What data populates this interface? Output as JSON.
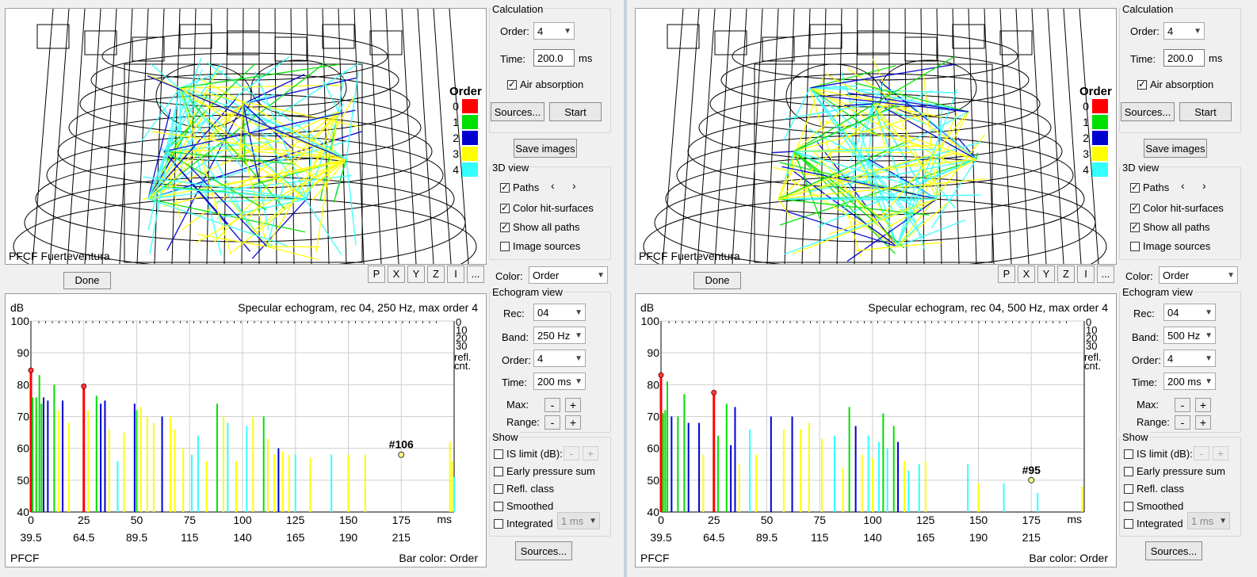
{
  "legend_colors": {
    "o0": "#ff0000",
    "o1": "#00e000",
    "o2": "#0000d0",
    "o3": "#ffff00",
    "o4": "#33ffff"
  },
  "panes": [
    {
      "room_label": "PFCF Fuerteventura",
      "legend": {
        "title": "Order",
        "items": [
          "0",
          "1",
          "2",
          "3",
          "4"
        ]
      },
      "status": "Done",
      "view_buttons": [
        "P",
        "X",
        "Y",
        "Z",
        "I",
        "..."
      ],
      "calc": {
        "title": "Calculation",
        "order_label": "Order:",
        "order_value": "4",
        "time_label": "Time:",
        "time_value": "200.0",
        "time_unit": "ms",
        "air_absorption": "Air absorption",
        "sources_btn": "Sources...",
        "start_btn": "Start"
      },
      "save_images": "Save images",
      "view3d": {
        "title": "3D view",
        "paths": "Paths",
        "nav_prev": "‹",
        "nav_next": "›",
        "color_hit": "Color hit-surfaces",
        "show_all": "Show all paths",
        "image_sources": "Image sources"
      },
      "color": {
        "label": "Color:",
        "value": "Order"
      },
      "echo_panel": {
        "title": "Echogram view",
        "rec_label": "Rec:",
        "rec_value": "04",
        "band_label": "Band:",
        "band_value": "250 Hz",
        "order_label": "Order:",
        "order_value": "4",
        "time_label": "Time:",
        "time_value": "200 ms",
        "max_label": "Max:",
        "range_label": "Range:",
        "minus": "-",
        "plus": "+"
      },
      "show": {
        "title": "Show",
        "is_limit": "IS limit (dB):",
        "early": "Early pressure sum",
        "refl": "Refl. class",
        "smoothed": "Smoothed",
        "integrated": "Integrated",
        "int_value": "1 ms",
        "minus": "-",
        "plus": "+"
      },
      "sources_bottom": "Sources...",
      "echogram": {
        "title": "Specular echogram, rec 04, 250 Hz, max order 4",
        "ylabel": "dB",
        "xunit": "ms",
        "footer_left": "PFCF",
        "footer_right": "Bar color: Order",
        "refl_ticks": [
          "0",
          "10",
          "20",
          "30"
        ],
        "refl_label1": "refl.",
        "refl_label2": "cnt.",
        "marker_label": "#106"
      },
      "chart_data": {
        "type": "bar",
        "title": "Specular echogram, rec 04, 250 Hz, max order 4",
        "ylabel": "dB",
        "xlabel": "ms",
        "ylim": [
          40,
          100
        ],
        "xlim": [
          0,
          200
        ],
        "yticks": [
          40,
          50,
          60,
          70,
          80,
          90,
          100
        ],
        "xticks": [
          0,
          25,
          50,
          75,
          100,
          125,
          150,
          175
        ],
        "xticks2": [
          "39.5",
          "64.5",
          "89.5",
          "115",
          "140",
          "165",
          "190",
          "215"
        ],
        "grid": true,
        "marker": {
          "x": 175,
          "y": 58,
          "label": "#106"
        },
        "bars": [
          {
            "x": 0,
            "v": 84.5,
            "o": 0
          },
          {
            "x": 0.8,
            "v": 76,
            "o": 1
          },
          {
            "x": 2.5,
            "v": 76,
            "o": 1
          },
          {
            "x": 4,
            "v": 83,
            "o": 1
          },
          {
            "x": 5,
            "v": 74,
            "o": 1
          },
          {
            "x": 6,
            "v": 76,
            "o": 2
          },
          {
            "x": 8,
            "v": 75,
            "o": 2
          },
          {
            "x": 11,
            "v": 80,
            "o": 1
          },
          {
            "x": 13,
            "v": 72,
            "o": 3
          },
          {
            "x": 15,
            "v": 75,
            "o": 2
          },
          {
            "x": 18,
            "v": 68,
            "o": 3
          },
          {
            "x": 25,
            "v": 79.5,
            "o": 0
          },
          {
            "x": 27,
            "v": 72,
            "o": 3
          },
          {
            "x": 31,
            "v": 76.5,
            "o": 1
          },
          {
            "x": 33,
            "v": 74,
            "o": 2
          },
          {
            "x": 35,
            "v": 75,
            "o": 2
          },
          {
            "x": 37,
            "v": 66,
            "o": 3
          },
          {
            "x": 41,
            "v": 56,
            "o": 4
          },
          {
            "x": 44,
            "v": 65,
            "o": 3
          },
          {
            "x": 49,
            "v": 74,
            "o": 2
          },
          {
            "x": 50,
            "v": 72,
            "o": 1
          },
          {
            "x": 52,
            "v": 73,
            "o": 3
          },
          {
            "x": 55,
            "v": 70,
            "o": 3
          },
          {
            "x": 58,
            "v": 68,
            "o": 3
          },
          {
            "x": 62,
            "v": 70,
            "o": 2
          },
          {
            "x": 66,
            "v": 70,
            "o": 3
          },
          {
            "x": 68,
            "v": 66,
            "o": 3
          },
          {
            "x": 72,
            "v": 60,
            "o": 3
          },
          {
            "x": 76,
            "v": 58,
            "o": 4
          },
          {
            "x": 79,
            "v": 64,
            "o": 4
          },
          {
            "x": 83,
            "v": 56,
            "o": 3
          },
          {
            "x": 88,
            "v": 74,
            "o": 1
          },
          {
            "x": 91,
            "v": 70,
            "o": 3
          },
          {
            "x": 93,
            "v": 68,
            "o": 4
          },
          {
            "x": 97,
            "v": 56,
            "o": 3
          },
          {
            "x": 102,
            "v": 67,
            "o": 4
          },
          {
            "x": 105,
            "v": 70,
            "o": 3
          },
          {
            "x": 110,
            "v": 70,
            "o": 1
          },
          {
            "x": 112,
            "v": 63,
            "o": 3
          },
          {
            "x": 115,
            "v": 58,
            "o": 3
          },
          {
            "x": 117,
            "v": 60,
            "o": 2
          },
          {
            "x": 119,
            "v": 59,
            "o": 3
          },
          {
            "x": 122,
            "v": 58,
            "o": 3
          },
          {
            "x": 125,
            "v": 58,
            "o": 4
          },
          {
            "x": 132,
            "v": 57,
            "o": 3
          },
          {
            "x": 142,
            "v": 58,
            "o": 4
          },
          {
            "x": 150,
            "v": 58,
            "o": 3
          },
          {
            "x": 158,
            "v": 58,
            "o": 3
          },
          {
            "x": 198,
            "v": 62,
            "o": 3
          },
          {
            "x": 199,
            "v": 56,
            "o": 3
          },
          {
            "x": 200,
            "v": 51,
            "o": 4
          }
        ]
      }
    },
    {
      "room_label": "PFCF Fuerteventura",
      "legend": {
        "title": "Order",
        "items": [
          "0",
          "1",
          "2",
          "3",
          "4"
        ]
      },
      "status": "Done",
      "view_buttons": [
        "P",
        "X",
        "Y",
        "Z",
        "I",
        "..."
      ],
      "calc": {
        "title": "Calculation",
        "order_label": "Order:",
        "order_value": "4",
        "time_label": "Time:",
        "time_value": "200.0",
        "time_unit": "ms",
        "air_absorption": "Air absorption",
        "sources_btn": "Sources...",
        "start_btn": "Start"
      },
      "save_images": "Save images",
      "view3d": {
        "title": "3D view",
        "paths": "Paths",
        "nav_prev": "‹",
        "nav_next": "›",
        "color_hit": "Color hit-surfaces",
        "show_all": "Show all paths",
        "image_sources": "Image sources"
      },
      "color": {
        "label": "Color:",
        "value": "Order"
      },
      "echo_panel": {
        "title": "Echogram view",
        "rec_label": "Rec:",
        "rec_value": "04",
        "band_label": "Band:",
        "band_value": "500 Hz",
        "order_label": "Order:",
        "order_value": "4",
        "time_label": "Time:",
        "time_value": "200 ms",
        "max_label": "Max:",
        "range_label": "Range:",
        "minus": "-",
        "plus": "+"
      },
      "show": {
        "title": "Show",
        "is_limit": "IS limit (dB):",
        "early": "Early pressure sum",
        "refl": "Refl. class",
        "smoothed": "Smoothed",
        "integrated": "Integrated",
        "int_value": "1 ms",
        "minus": "-",
        "plus": "+"
      },
      "sources_bottom": "Sources...",
      "echogram": {
        "title": "Specular echogram, rec 04, 500 Hz, max order 4",
        "ylabel": "dB",
        "xunit": "ms",
        "footer_left": "PFCF",
        "footer_right": "Bar color: Order",
        "refl_ticks": [
          "0",
          "10",
          "20",
          "30"
        ],
        "refl_label1": "refl.",
        "refl_label2": "cnt.",
        "marker_label": "#95"
      },
      "chart_data": {
        "type": "bar",
        "title": "Specular echogram, rec 04, 500 Hz, max order 4",
        "ylabel": "dB",
        "xlabel": "ms",
        "ylim": [
          40,
          100
        ],
        "xlim": [
          0,
          200
        ],
        "yticks": [
          40,
          50,
          60,
          70,
          80,
          90,
          100
        ],
        "xticks": [
          0,
          25,
          50,
          75,
          100,
          125,
          150,
          175
        ],
        "xticks2": [
          "39.5",
          "64.5",
          "89.5",
          "115",
          "140",
          "165",
          "190",
          "215"
        ],
        "grid": true,
        "marker": {
          "x": 175,
          "y": 50,
          "label": "#95"
        },
        "bars": [
          {
            "x": 0,
            "v": 83,
            "o": 0
          },
          {
            "x": 1,
            "v": 71,
            "o": 1
          },
          {
            "x": 2,
            "v": 72,
            "o": 1
          },
          {
            "x": 3,
            "v": 81,
            "o": 1
          },
          {
            "x": 5,
            "v": 70,
            "o": 2
          },
          {
            "x": 8,
            "v": 70,
            "o": 1
          },
          {
            "x": 11,
            "v": 77,
            "o": 1
          },
          {
            "x": 13,
            "v": 68,
            "o": 2
          },
          {
            "x": 18,
            "v": 68,
            "o": 2
          },
          {
            "x": 20,
            "v": 58,
            "o": 3
          },
          {
            "x": 25,
            "v": 77.5,
            "o": 0
          },
          {
            "x": 27,
            "v": 64,
            "o": 1
          },
          {
            "x": 31,
            "v": 74,
            "o": 1
          },
          {
            "x": 33,
            "v": 61,
            "o": 2
          },
          {
            "x": 35,
            "v": 73,
            "o": 2
          },
          {
            "x": 37,
            "v": 55,
            "o": 3
          },
          {
            "x": 42,
            "v": 66,
            "o": 4
          },
          {
            "x": 45,
            "v": 58,
            "o": 3
          },
          {
            "x": 52,
            "v": 70,
            "o": 2
          },
          {
            "x": 58,
            "v": 66,
            "o": 3
          },
          {
            "x": 62,
            "v": 70,
            "o": 2
          },
          {
            "x": 66,
            "v": 66,
            "o": 3
          },
          {
            "x": 70,
            "v": 68,
            "o": 3
          },
          {
            "x": 76,
            "v": 63,
            "o": 3
          },
          {
            "x": 82,
            "v": 64,
            "o": 4
          },
          {
            "x": 86,
            "v": 54,
            "o": 3
          },
          {
            "x": 89,
            "v": 73,
            "o": 1
          },
          {
            "x": 92,
            "v": 67,
            "o": 2
          },
          {
            "x": 95,
            "v": 58,
            "o": 3
          },
          {
            "x": 98,
            "v": 64,
            "o": 4
          },
          {
            "x": 100,
            "v": 57,
            "o": 3
          },
          {
            "x": 103,
            "v": 62,
            "o": 4
          },
          {
            "x": 105,
            "v": 71,
            "o": 1
          },
          {
            "x": 107,
            "v": 60,
            "o": 4
          },
          {
            "x": 110,
            "v": 67,
            "o": 1
          },
          {
            "x": 112,
            "v": 62,
            "o": 2
          },
          {
            "x": 115,
            "v": 56,
            "o": 3
          },
          {
            "x": 117,
            "v": 53,
            "o": 4
          },
          {
            "x": 122,
            "v": 55,
            "o": 4
          },
          {
            "x": 125,
            "v": 56,
            "o": 3
          },
          {
            "x": 145,
            "v": 55,
            "o": 4
          },
          {
            "x": 150,
            "v": 49,
            "o": 3
          },
          {
            "x": 162,
            "v": 49,
            "o": 4
          },
          {
            "x": 178,
            "v": 46,
            "o": 4
          },
          {
            "x": 199,
            "v": 48,
            "o": 3
          }
        ]
      }
    }
  ]
}
